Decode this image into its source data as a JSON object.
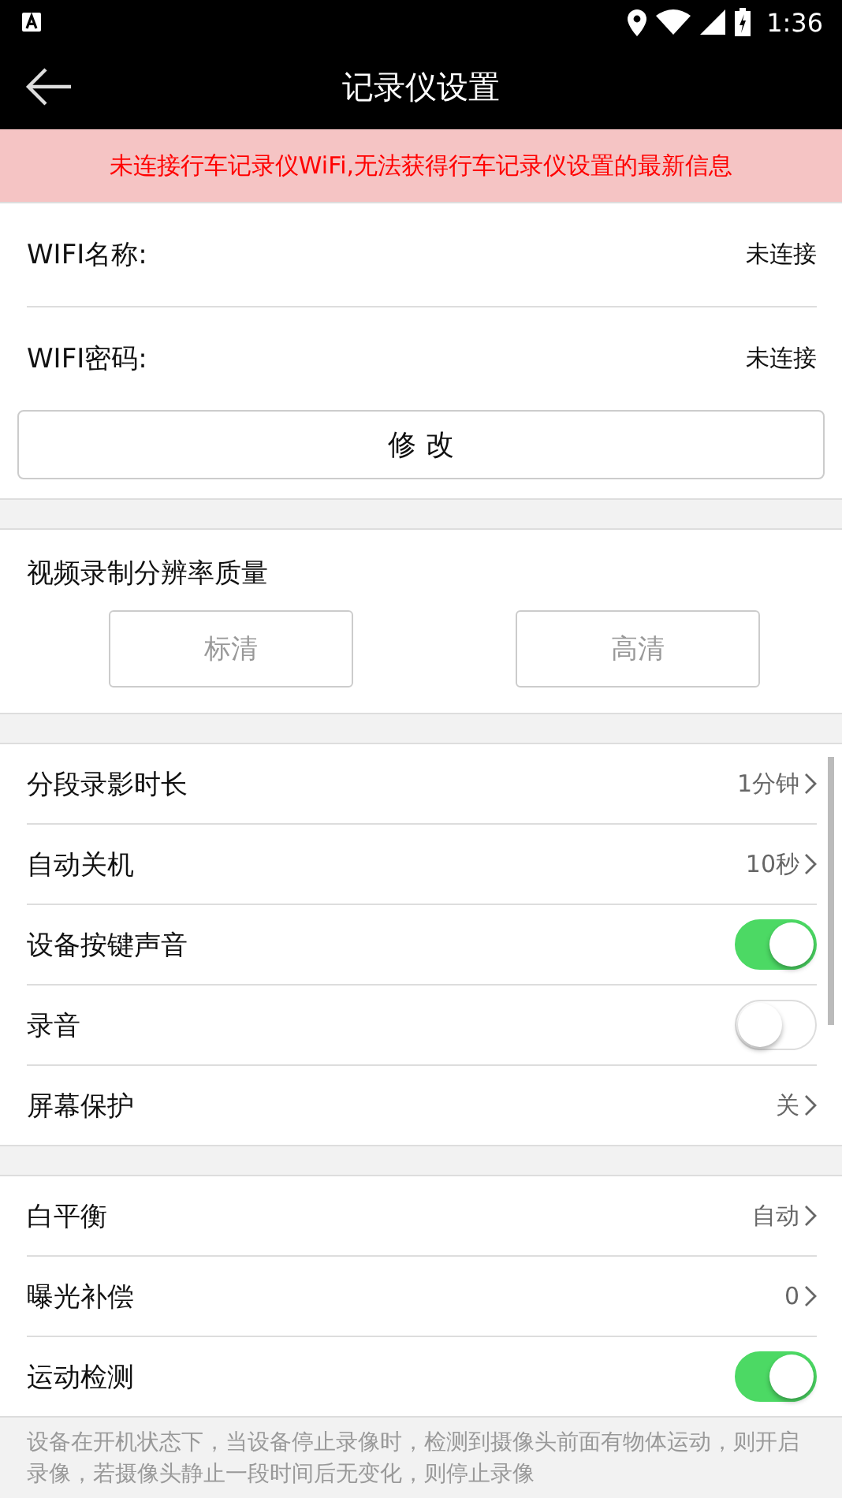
{
  "status_bar": {
    "time": "1:36"
  },
  "toolbar": {
    "title": "记录仪设置"
  },
  "banner": "未连接行车记录仪WiFi,无法获得行车记录仪设置的最新信息",
  "wifi": {
    "rows": [
      {
        "label": "WIFI名称:",
        "value": "未连接"
      },
      {
        "label": "WIFI密码:",
        "value": "未连接"
      }
    ],
    "button": "修 改"
  },
  "quality": {
    "title": "视频录制分辨率质量",
    "options": [
      {
        "label": "标清",
        "selected": false
      },
      {
        "label": "高清",
        "selected": false
      }
    ]
  },
  "groups": [
    [
      {
        "kind": "link",
        "label": "分段录影时长",
        "value": "1分钟"
      },
      {
        "kind": "link",
        "label": "自动关机",
        "value": "10秒"
      },
      {
        "kind": "toggle",
        "label": "设备按键声音",
        "on": true
      },
      {
        "kind": "toggle",
        "label": "录音",
        "on": false
      },
      {
        "kind": "link",
        "label": "屏幕保护",
        "value": "关"
      }
    ],
    [
      {
        "kind": "link",
        "label": "白平衡",
        "value": "自动"
      },
      {
        "kind": "link",
        "label": "曝光补偿",
        "value": "0"
      },
      {
        "kind": "toggle",
        "label": "运动检测",
        "on": true
      }
    ]
  ],
  "footer_note": "设备在开机状态下，当设备停止录像时，检测到摄像头前面有物体运动，则开启录像，若摄像头静止一段时间后无变化，则停止录像"
}
